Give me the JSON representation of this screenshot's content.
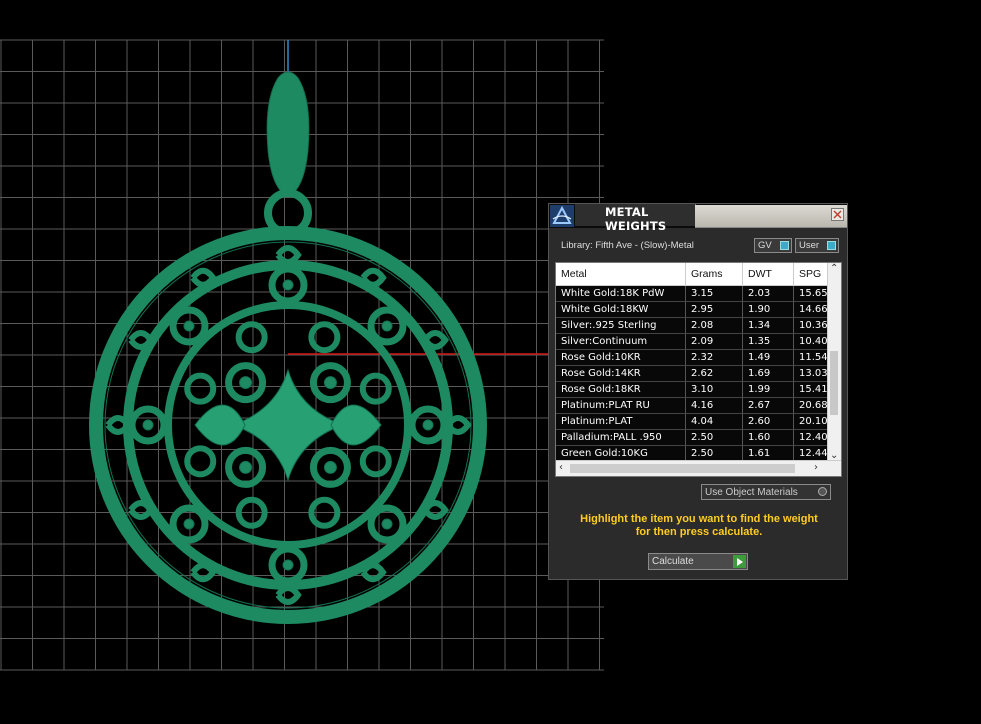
{
  "panel": {
    "title": "METAL WEIGHTS",
    "library_label": "Library: Fifth Ave - (Slow)-Metal",
    "toggle_gv": "GV",
    "toggle_user": "User",
    "use_object_materials": "Use Object Materials",
    "instructions_line1": "Highlight the item you want to find the weight",
    "instructions_line2": "for then press calculate.",
    "calculate_label": "Calculate"
  },
  "table": {
    "headers": [
      "Metal",
      "Grams",
      "DWT",
      "SPG"
    ],
    "rows": [
      [
        "White Gold:18K PdW",
        "3.15",
        "2.03",
        "15.65"
      ],
      [
        "White Gold:18KW",
        "2.95",
        "1.90",
        "14.66"
      ],
      [
        "Silver:.925 Sterling",
        "2.08",
        "1.34",
        "10.36"
      ],
      [
        "Silver:Continuum",
        "2.09",
        "1.35",
        "10.40"
      ],
      [
        "Rose Gold:10KR",
        "2.32",
        "1.49",
        "11.54"
      ],
      [
        "Rose Gold:14KR",
        "2.62",
        "1.69",
        "13.03"
      ],
      [
        "Rose Gold:18KR",
        "3.10",
        "1.99",
        "15.41"
      ],
      [
        "Platinum:PLAT RU",
        "4.16",
        "2.67",
        "20.68"
      ],
      [
        "Platinum:PLAT",
        "4.04",
        "2.60",
        "20.10"
      ],
      [
        "Palladium:PALL .950",
        "2.50",
        "1.60",
        "12.40"
      ],
      [
        "Green Gold:10KG",
        "2.50",
        "1.61",
        "12.44"
      ]
    ]
  },
  "colors": {
    "model": "#1d8a62",
    "grid": "#6a6a6a",
    "axis_y": "#2a8fd0",
    "axis_x": "#d01818",
    "instructions": "#ffcc22"
  }
}
